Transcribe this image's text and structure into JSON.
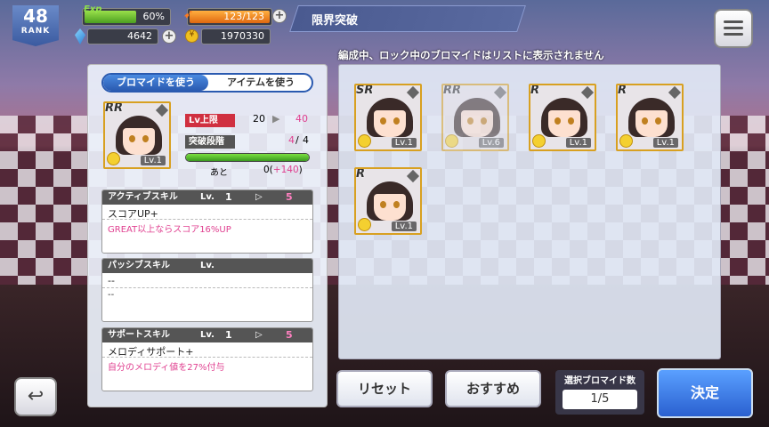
{
  "header": {
    "rank_value": "48",
    "rank_label": "RANK",
    "exp_label": "Exp",
    "exp_percent": "60%",
    "exp_fill": 0.6,
    "stamina": "123/123",
    "gems": "4642",
    "coins": "1970330",
    "screen_title": "限界突破"
  },
  "notice": "編成中、ロック中のブロマイドはリストに表示されません",
  "tabs": {
    "use_bromide": "ブロマイドを使う",
    "use_item": "アイテムを使う"
  },
  "selected_card": {
    "rarity": "RR",
    "level": "Lv.1"
  },
  "limit": {
    "lv_cap_label": "Lv上限",
    "lv_from": "20",
    "lv_to": "40",
    "stage_label": "突破段階",
    "stage_current": "4",
    "stage_sep": "/",
    "stage_max": "4",
    "remaining_label": "あと",
    "remaining_value": "0(",
    "remaining_gain": "+140",
    "remaining_close": ")",
    "gauge_fill": 1.0
  },
  "skills": [
    {
      "header": "アクティブスキル",
      "lv_label": "Lv.",
      "lv_from": "1",
      "arrow": "▷",
      "lv_to": "5",
      "name": "スコアUP+",
      "desc": "GREAT以上ならスコア16%UP"
    },
    {
      "header": "パッシブスキル",
      "lv_label": "Lv.",
      "lv_from": "",
      "arrow": "",
      "lv_to": "",
      "name": "--",
      "desc": "--"
    },
    {
      "header": "サポートスキル",
      "lv_label": "Lv.",
      "lv_from": "1",
      "arrow": "▷",
      "lv_to": "5",
      "name": "メロディサポート+",
      "desc": "自分のメロディ値を27%付与"
    }
  ],
  "list_cards": [
    {
      "rarity": "SR",
      "level": "Lv.1"
    },
    {
      "rarity": "RR",
      "level": "Lv.6"
    },
    {
      "rarity": "R",
      "level": "Lv.1"
    },
    {
      "rarity": "R",
      "level": "Lv.1"
    },
    {
      "rarity": "R",
      "level": "Lv.1"
    }
  ],
  "buttons": {
    "reset": "リセット",
    "recommend": "おすすめ",
    "decide": "決定",
    "back": "↩"
  },
  "selection": {
    "label": "選択ブロマイド数",
    "value": "1/5"
  }
}
